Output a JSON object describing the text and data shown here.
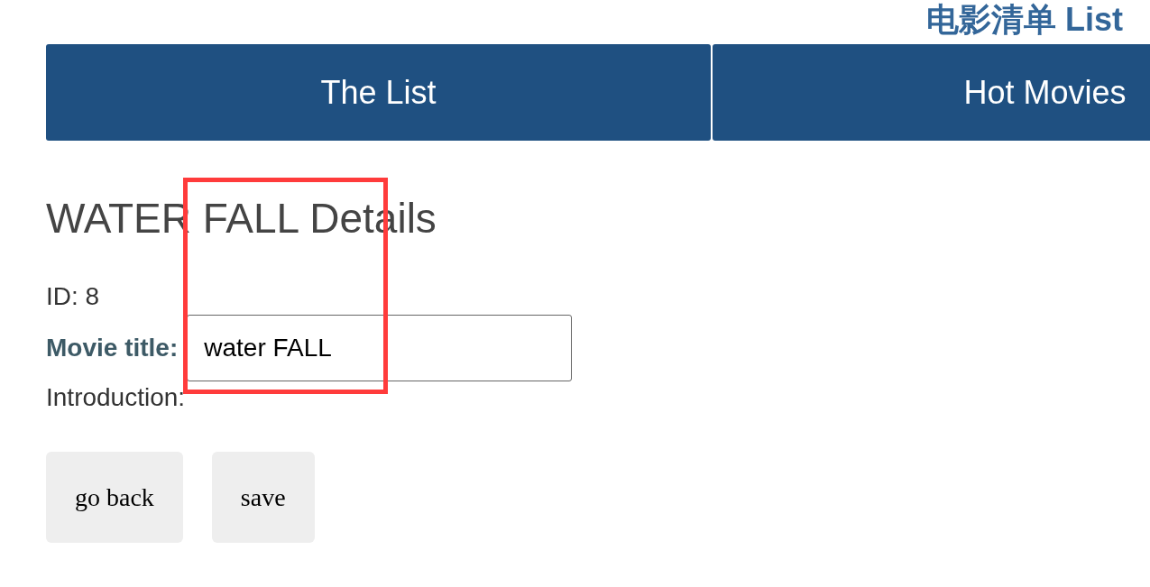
{
  "app_title": "电影清单 List",
  "nav": [
    {
      "label": "The List"
    },
    {
      "label": "Hot Movies"
    }
  ],
  "detail": {
    "heading": "WATER FALL Details",
    "id_line": "ID: 8",
    "title_label": "Movie title:",
    "title_value": "water FALL",
    "intro_label": "Introduction:"
  },
  "buttons": [
    "go back",
    "save"
  ]
}
